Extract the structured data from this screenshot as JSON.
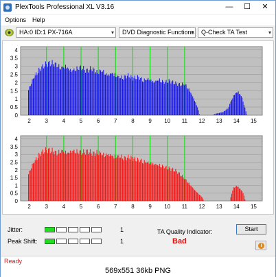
{
  "window": {
    "title": "PlexTools Professional XL V3.16",
    "controls": {
      "minimize": "—",
      "maximize": "☐",
      "close": "✕"
    }
  },
  "menu": {
    "options": "Options",
    "help": "Help"
  },
  "toolbar": {
    "drive": "HA:0 ID:1  PX-716A",
    "function": "DVD Diagnostic Functions",
    "test": "Q-Check TA Test",
    "arrow": "▾"
  },
  "charts": {
    "x_ticks": [
      "2",
      "3",
      "4",
      "5",
      "6",
      "7",
      "8",
      "9",
      "10",
      "11",
      "12",
      "13",
      "14",
      "15"
    ],
    "y_ticks": [
      "4",
      "3.5",
      "3",
      "2.5",
      "2",
      "1.5",
      "1",
      "0.5",
      "0"
    ]
  },
  "chart_data": [
    {
      "type": "bar",
      "name": "top",
      "color": "#0000ee",
      "xlim": [
        1.5,
        15.5
      ],
      "ylim": [
        0,
        4.2
      ],
      "green_lines": [
        3,
        4,
        5,
        6,
        7,
        8,
        9,
        10,
        11
      ],
      "segments": [
        {
          "x": [
            1.9,
            2.2,
            2.5,
            2.8,
            3.0,
            3.3,
            3.6,
            3.8,
            4.1,
            4.4,
            4.7,
            5.0,
            5.3,
            5.6,
            5.9,
            6.2,
            6.5,
            6.8,
            7.1,
            7.4,
            7.7,
            8.0,
            8.3,
            8.6,
            8.9,
            9.2,
            9.5,
            9.8,
            10.1,
            10.4,
            10.7,
            11.0,
            11.3,
            11.6,
            11.8,
            11.85
          ],
          "y": [
            1.6,
            2.4,
            2.9,
            3.2,
            3.35,
            3.4,
            3.3,
            3.1,
            3.25,
            2.95,
            3.05,
            3.15,
            2.9,
            3.05,
            2.8,
            2.95,
            2.65,
            2.8,
            2.55,
            2.45,
            2.6,
            2.4,
            2.5,
            2.3,
            2.4,
            2.2,
            2.35,
            2.15,
            2.25,
            2.1,
            2.0,
            2.05,
            1.6,
            0.9,
            0.3,
            0.0
          ]
        },
        {
          "x": [
            12.6,
            12.8,
            13.0,
            13.2,
            13.5,
            13.7,
            13.9,
            14.1,
            14.3,
            14.5,
            14.6
          ],
          "y": [
            0.0,
            0.1,
            0.15,
            0.2,
            0.45,
            1.0,
            1.45,
            1.55,
            1.2,
            0.4,
            0.0
          ]
        }
      ]
    },
    {
      "type": "bar",
      "name": "bottom",
      "color": "#ff0000",
      "xlim": [
        1.5,
        15.5
      ],
      "ylim": [
        0,
        4.2
      ],
      "green_lines": [
        3,
        4,
        5,
        6,
        7,
        8,
        9,
        10,
        11
      ],
      "segments": [
        {
          "x": [
            1.9,
            2.2,
            2.5,
            2.8,
            3.0,
            3.3,
            3.6,
            3.9,
            4.2,
            4.5,
            4.8,
            5.1,
            5.4,
            5.7,
            6.0,
            6.3,
            6.6,
            6.9,
            7.2,
            7.5,
            7.8,
            8.1,
            8.4,
            8.7,
            9.0,
            9.3,
            9.6,
            9.9,
            10.2,
            10.5,
            10.8,
            11.1,
            11.4,
            11.7,
            12.0,
            12.1
          ],
          "y": [
            1.8,
            2.6,
            3.1,
            3.4,
            3.5,
            3.45,
            3.3,
            3.5,
            3.35,
            3.5,
            3.4,
            3.35,
            3.4,
            3.25,
            3.35,
            3.2,
            3.25,
            3.1,
            3.1,
            2.95,
            3.0,
            2.85,
            2.8,
            2.7,
            2.65,
            2.55,
            2.45,
            2.3,
            2.2,
            2.05,
            1.75,
            1.4,
            1.0,
            0.6,
            0.25,
            0.0
          ]
        },
        {
          "x": [
            13.6,
            13.8,
            14.0,
            14.2,
            14.4,
            14.5
          ],
          "y": [
            0.0,
            0.9,
            1.05,
            0.85,
            0.5,
            0.0
          ]
        }
      ]
    }
  ],
  "bottom": {
    "jitter_label": "Jitter:",
    "peak_shift_label": "Peak Shift:",
    "jitter_value": "1",
    "peak_shift_value": "1",
    "jitter_level": 1,
    "peak_shift_level": 1,
    "meter_cells": 5,
    "ta_label": "TA Quality Indicator:",
    "ta_value": "Bad",
    "start_label": "Start",
    "info_icon": "i"
  },
  "status": {
    "text": "Ready"
  },
  "caption": "569x551  36kb  PNG"
}
